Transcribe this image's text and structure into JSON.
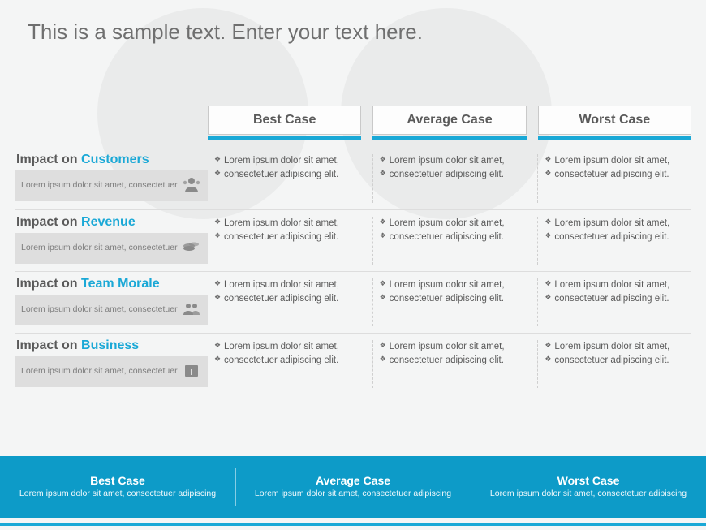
{
  "title": "This is a sample text. Enter your text here.",
  "accent_color": "#1aa8d6",
  "footer_color": "#0d9bc8",
  "columns": [
    {
      "label": "Best Case"
    },
    {
      "label": "Average Case"
    },
    {
      "label": "Worst Case"
    }
  ],
  "rows": [
    {
      "title_prefix": "Impact on ",
      "title_accent": "Customers",
      "sub": "Lorem ipsum dolor sit amet, consectetuer",
      "icon": "customers-icon",
      "cells": [
        [
          "Lorem ipsum dolor sit amet,",
          "consectetuer adipiscing elit."
        ],
        [
          "Lorem ipsum dolor sit amet,",
          "consectetuer adipiscing elit."
        ],
        [
          "Lorem ipsum dolor sit amet,",
          "consectetuer adipiscing elit."
        ]
      ]
    },
    {
      "title_prefix": "Impact on ",
      "title_accent": "Revenue",
      "sub": "Lorem ipsum dolor sit amet, consectetuer",
      "icon": "revenue-icon",
      "cells": [
        [
          "Lorem ipsum dolor sit amet,",
          "consectetuer adipiscing elit."
        ],
        [
          "Lorem ipsum dolor sit amet,",
          "consectetuer adipiscing elit."
        ],
        [
          "Lorem ipsum dolor sit amet,",
          "consectetuer adipiscing elit."
        ]
      ]
    },
    {
      "title_prefix": "Impact on ",
      "title_accent": "Team Morale",
      "sub": "Lorem ipsum dolor sit amet, consectetuer",
      "icon": "team-icon",
      "cells": [
        [
          "Lorem ipsum dolor sit amet,",
          "consectetuer adipiscing elit."
        ],
        [
          "Lorem ipsum dolor sit amet,",
          "consectetuer adipiscing elit."
        ],
        [
          "Lorem ipsum dolor sit amet,",
          "consectetuer adipiscing elit."
        ]
      ]
    },
    {
      "title_prefix": "Impact on ",
      "title_accent": "Business",
      "sub": "Lorem ipsum dolor sit amet, consectetuer",
      "icon": "business-icon",
      "cells": [
        [
          "Lorem ipsum dolor sit amet,",
          "consectetuer adipiscing elit."
        ],
        [
          "Lorem ipsum dolor sit amet,",
          "consectetuer adipiscing elit."
        ],
        [
          "Lorem ipsum dolor sit amet,",
          "consectetuer adipiscing elit."
        ]
      ]
    }
  ],
  "footer": [
    {
      "title": "Best Case",
      "sub": "Lorem ipsum dolor sit amet, consectetuer adipiscing"
    },
    {
      "title": "Average Case",
      "sub": "Lorem ipsum dolor sit amet, consectetuer adipiscing"
    },
    {
      "title": "Worst Case",
      "sub": "Lorem ipsum dolor sit amet, consectetuer adipiscing"
    }
  ]
}
